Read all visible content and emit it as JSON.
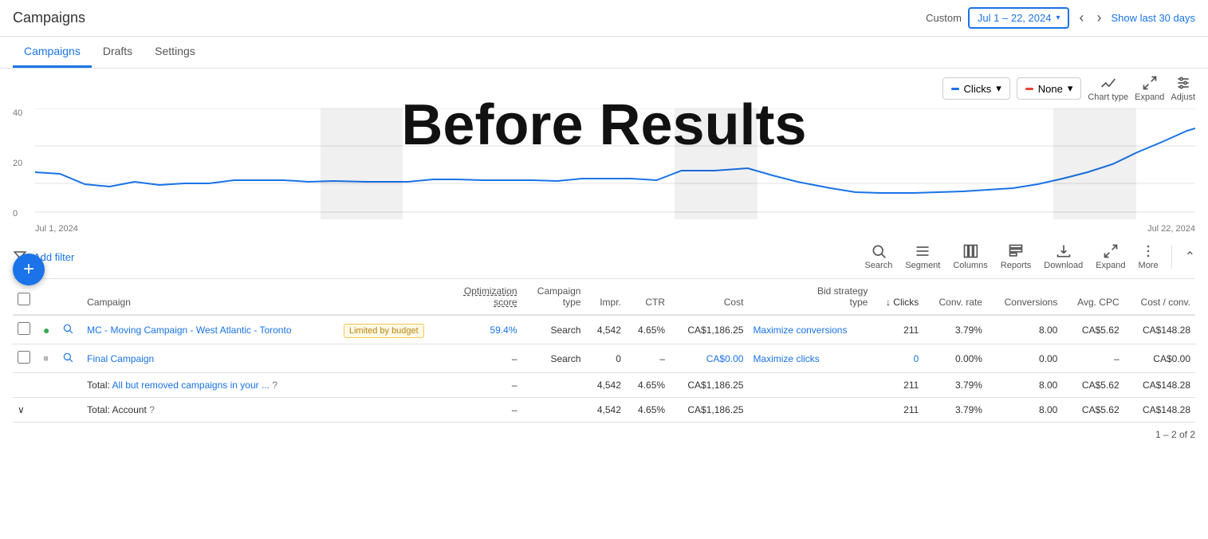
{
  "header": {
    "title": "Campaigns",
    "custom_label": "Custom",
    "date_range": "Jul 1 – 22, 2024",
    "show_last": "Show last 30 days"
  },
  "tabs": [
    {
      "label": "Campaigns",
      "active": true
    },
    {
      "label": "Drafts",
      "active": false
    },
    {
      "label": "Settings",
      "active": false
    }
  ],
  "overlay": "Before Results",
  "chart": {
    "metric1_label": "Clicks",
    "metric2_label": "None",
    "chart_type_label": "Chart type",
    "expand_label": "Expand",
    "adjust_label": "Adjust",
    "x_start": "Jul 1, 2024",
    "x_end": "Jul 22, 2024",
    "y_labels": [
      "40",
      "20",
      "0"
    ]
  },
  "filter": {
    "add_filter_label": "Add filter",
    "actions": [
      {
        "label": "Search",
        "icon": "search"
      },
      {
        "label": "Segment",
        "icon": "segment"
      },
      {
        "label": "Columns",
        "icon": "columns"
      },
      {
        "label": "Reports",
        "icon": "reports"
      },
      {
        "label": "Download",
        "icon": "download"
      },
      {
        "label": "Expand",
        "icon": "expand"
      },
      {
        "label": "More",
        "icon": "more"
      }
    ]
  },
  "table": {
    "headers": [
      {
        "label": "",
        "key": "checkbox"
      },
      {
        "label": "",
        "key": "status_dot"
      },
      {
        "label": "",
        "key": "search_icon"
      },
      {
        "label": "Campaign",
        "key": "campaign"
      },
      {
        "label": "",
        "key": "badge"
      },
      {
        "label": "Optimization score",
        "key": "opt_score",
        "dashed": true
      },
      {
        "label": "Campaign type",
        "key": "campaign_type"
      },
      {
        "label": "Impr.",
        "key": "impr"
      },
      {
        "label": "CTR",
        "key": "ctr"
      },
      {
        "label": "Cost",
        "key": "cost"
      },
      {
        "label": "Bid strategy type",
        "key": "bid_strategy"
      },
      {
        "label": "↓ Clicks",
        "key": "clicks",
        "sorted": true
      },
      {
        "label": "Conv. rate",
        "key": "conv_rate"
      },
      {
        "label": "Conversions",
        "key": "conversions"
      },
      {
        "label": "Avg. CPC",
        "key": "avg_cpc"
      },
      {
        "label": "Cost / conv.",
        "key": "cost_conv"
      }
    ],
    "rows": [
      {
        "checkbox": false,
        "status": "green",
        "campaign": "MC - Moving Campaign - West Atlantic - Toronto",
        "badge": "Limited by budget",
        "opt_score": "59.4%",
        "campaign_type": "Search",
        "impr": "4,542",
        "ctr": "4.65%",
        "cost": "CA$1,186.25",
        "bid_strategy": "Maximize conversions",
        "clicks": "211",
        "conv_rate": "3.79%",
        "conversions": "8.00",
        "avg_cpc": "CA$5.62",
        "cost_conv": "CA$148.28"
      },
      {
        "checkbox": false,
        "status": "pause",
        "campaign": "Final Campaign",
        "badge": "",
        "opt_score": "–",
        "campaign_type": "Search",
        "impr": "0",
        "ctr": "–",
        "cost": "CA$0.00",
        "bid_strategy": "Maximize clicks",
        "clicks": "0",
        "conv_rate": "0.00%",
        "conversions": "0.00",
        "avg_cpc": "–",
        "cost_conv": "CA$0.00"
      }
    ],
    "total_row": {
      "label": "Total: All but removed campaigns in your ...",
      "impr": "4,542",
      "ctr": "4.65%",
      "cost": "CA$1,186.25",
      "clicks": "211",
      "conv_rate": "3.79%",
      "conversions": "8.00",
      "avg_cpc": "CA$5.62",
      "cost_conv": "CA$148.28",
      "opt_score": "–"
    },
    "account_row": {
      "label": "Total: Account",
      "impr": "4,542",
      "ctr": "4.65%",
      "cost": "CA$1,186.25",
      "clicks": "211",
      "conv_rate": "3.79%",
      "conversions": "8.00",
      "avg_cpc": "CA$5.62",
      "cost_conv": "CA$148.28",
      "opt_score": "–"
    }
  },
  "pagination": "1 – 2 of 2",
  "fab_icon": "+"
}
